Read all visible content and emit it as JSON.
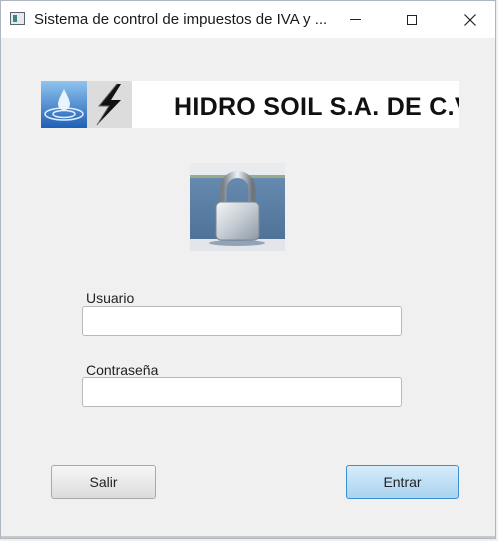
{
  "window": {
    "title": "Sistema de control de impuestos de IVA y ..."
  },
  "banner": {
    "company": "HIDRO SOIL S.A. DE C.V"
  },
  "form": {
    "user_label": "Usuario",
    "user_value": "",
    "password_label": "Contraseña",
    "password_value": ""
  },
  "buttons": {
    "exit_label": "Salir",
    "enter_label": "Entrar"
  },
  "colors": {
    "accent_button": "#a9d3f0",
    "window_bg": "#f0f0f0"
  }
}
